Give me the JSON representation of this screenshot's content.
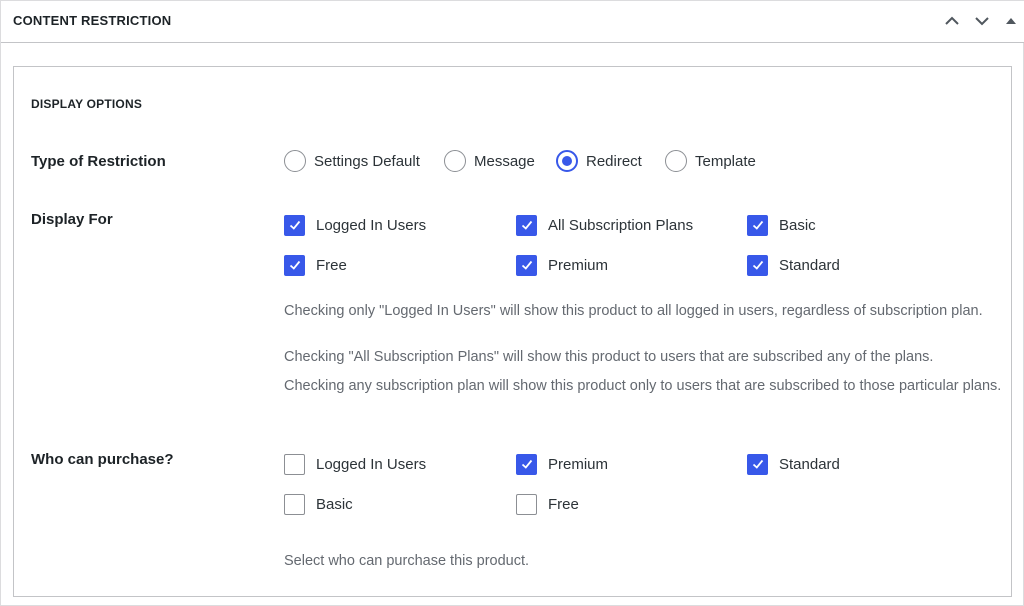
{
  "header": {
    "title": "CONTENT RESTRICTION",
    "move_up_icon": "chevron-up-icon",
    "move_down_icon": "chevron-down-icon",
    "toggle_icon": "triangle-up-icon"
  },
  "section": {
    "title": "DISPLAY OPTIONS"
  },
  "type_of_restriction": {
    "label": "Type of Restriction",
    "options": [
      {
        "label": "Settings Default",
        "checked": false
      },
      {
        "label": "Message",
        "checked": false
      },
      {
        "label": "Redirect",
        "checked": true
      },
      {
        "label": "Template",
        "checked": false
      }
    ]
  },
  "display_for": {
    "label": "Display For",
    "options": [
      {
        "label": "Logged In Users",
        "checked": true
      },
      {
        "label": "All Subscription Plans",
        "checked": true
      },
      {
        "label": "Basic",
        "checked": true
      },
      {
        "label": "Free",
        "checked": true
      },
      {
        "label": "Premium",
        "checked": true
      },
      {
        "label": "Standard",
        "checked": true
      }
    ],
    "help": [
      "Checking only \"Logged In Users\" will show this product to all logged in users, regardless of subscription plan.",
      "Checking \"All Subscription Plans\" will show this product to users that are subscribed any of the plans.",
      "Checking any subscription plan will show this product only to users that are subscribed to those particular plans."
    ]
  },
  "who_can_purchase": {
    "label": "Who can purchase?",
    "options": [
      {
        "label": "Logged In Users",
        "checked": false
      },
      {
        "label": "Premium",
        "checked": true
      },
      {
        "label": "Standard",
        "checked": true
      },
      {
        "label": "Basic",
        "checked": false
      },
      {
        "label": "Free",
        "checked": false
      }
    ],
    "help": "Select who can purchase this product."
  },
  "colors": {
    "accent": "#3858e9",
    "border": "#8c8f94",
    "help_text": "#646970"
  }
}
